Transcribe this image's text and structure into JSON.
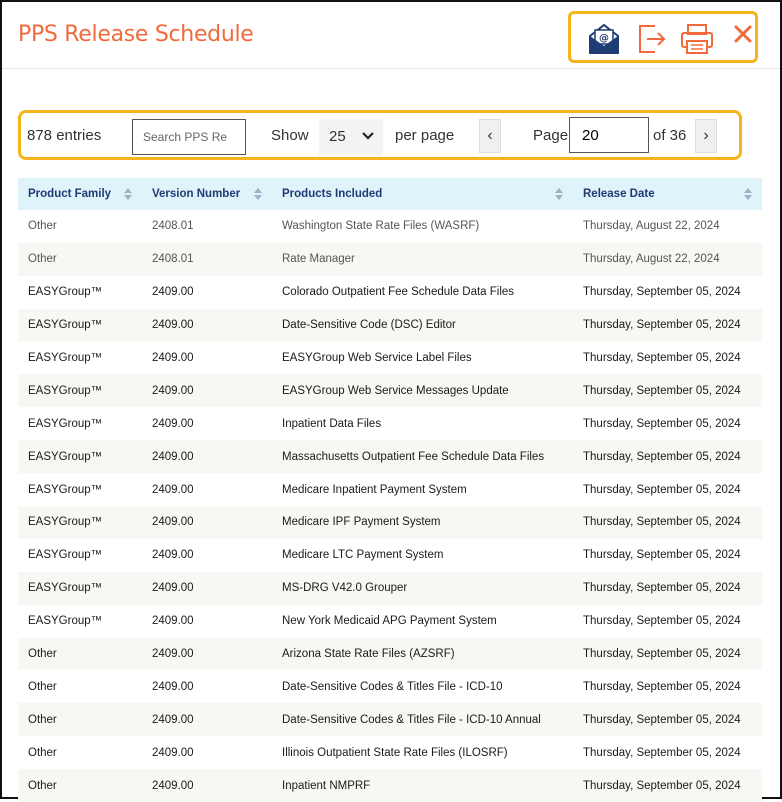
{
  "header": {
    "title": "PPS Release Schedule"
  },
  "controls": {
    "entries": "878 entries",
    "search_placeholder": "Search PPS Re",
    "show_label": "Show",
    "per_page_value": "25",
    "per_page_label": "per page",
    "page_label": "Page",
    "page_value": "20",
    "page_of": "of 36"
  },
  "table": {
    "columns": [
      "Product Family",
      "Version Number",
      "Products Included",
      "Release Date"
    ],
    "rows": [
      [
        "Other",
        "2408.01",
        "Washington State Rate Files (WASRF)",
        "Thursday, August 22, 2024"
      ],
      [
        "Other",
        "2408.01",
        "Rate Manager",
        "Thursday, August 22, 2024"
      ],
      [
        "EASYGroup™",
        "2409.00",
        "Colorado Outpatient Fee Schedule Data Files",
        "Thursday, September 05, 2024"
      ],
      [
        "EASYGroup™",
        "2409.00",
        "Date-Sensitive Code (DSC) Editor",
        "Thursday, September 05, 2024"
      ],
      [
        "EASYGroup™",
        "2409.00",
        "EASYGroup Web Service Label Files",
        "Thursday, September 05, 2024"
      ],
      [
        "EASYGroup™",
        "2409.00",
        "EASYGroup Web Service Messages Update",
        "Thursday, September 05, 2024"
      ],
      [
        "EASYGroup™",
        "2409.00",
        "Inpatient Data Files",
        "Thursday, September 05, 2024"
      ],
      [
        "EASYGroup™",
        "2409.00",
        "Massachusetts Outpatient Fee Schedule Data Files",
        "Thursday, September 05, 2024"
      ],
      [
        "EASYGroup™",
        "2409.00",
        "Medicare Inpatient Payment System",
        "Thursday, September 05, 2024"
      ],
      [
        "EASYGroup™",
        "2409.00",
        "Medicare IPF Payment System",
        "Thursday, September 05, 2024"
      ],
      [
        "EASYGroup™",
        "2409.00",
        "Medicare LTC Payment System",
        "Thursday, September 05, 2024"
      ],
      [
        "EASYGroup™",
        "2409.00",
        "MS-DRG V42.0 Grouper",
        "Thursday, September 05, 2024"
      ],
      [
        "EASYGroup™",
        "2409.00",
        "New York Medicaid APG Payment System",
        "Thursday, September 05, 2024"
      ],
      [
        "Other",
        "2409.00",
        "Arizona State Rate Files (AZSRF)",
        "Thursday, September 05, 2024"
      ],
      [
        "Other",
        "2409.00",
        "Date-Sensitive Codes & Titles File - ICD-10",
        "Thursday, September 05, 2024"
      ],
      [
        "Other",
        "2409.00",
        "Date-Sensitive Codes & Titles File - ICD-10 Annual",
        "Thursday, September 05, 2024"
      ],
      [
        "Other",
        "2409.00",
        "Illinois Outpatient State Rate Files (ILOSRF)",
        "Thursday, September 05, 2024"
      ],
      [
        "Other",
        "2409.00",
        "Inpatient NMPRF",
        "Thursday, September 05, 2024"
      ]
    ]
  },
  "icons": {
    "email": "email-icon",
    "export": "export-icon",
    "print": "print-icon",
    "close": "close-icon",
    "sort": "sort-icon"
  },
  "colors": {
    "accent": "#f26a3b",
    "highlight": "#f5b41b",
    "header_bg": "#dff3fb",
    "header_text": "#1f3b73"
  }
}
